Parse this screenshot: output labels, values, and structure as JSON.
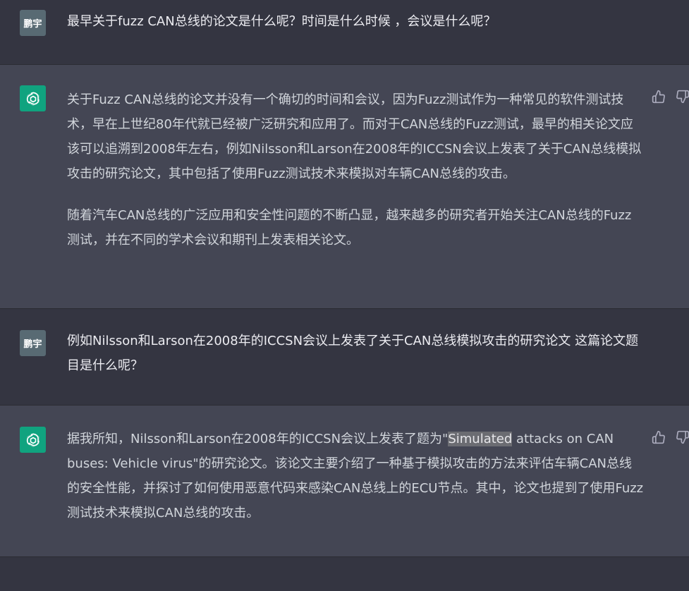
{
  "messages": [
    {
      "role": "user",
      "avatar": "鹏宇",
      "text": "最早关于fuzz CAN总线的论文是什么呢？时间是什么时候 ，会议是什么呢？"
    },
    {
      "role": "assistant",
      "avatar_icon": "openai-logo-icon",
      "paragraphs": [
        "关于Fuzz CAN总线的论文并没有一个确切的时间和会议，因为Fuzz测试作为一种常见的软件测试技术，早在上世纪80年代就已经被广泛研究和应用了。而对于CAN总线的Fuzz测试，最早的相关论文应该可以追溯到2008年左右，例如Nilsson和Larson在2008年的ICCSN会议上发表了关于CAN总线模拟攻击的研究论文，其中包括了使用Fuzz测试技术来模拟对车辆CAN总线的攻击。",
        "随着汽车CAN总线的广泛应用和安全性问题的不断凸显，越来越多的研究者开始关注CAN总线的Fuzz测试，并在不同的学术会议和期刊上发表相关论文。"
      ]
    },
    {
      "role": "user",
      "avatar": "鹏宇",
      "text": "例如Nilsson和Larson在2008年的ICCSN会议上发表了关于CAN总线模拟攻击的研究论文 这篇论文题目是什么呢？"
    },
    {
      "role": "assistant",
      "avatar_icon": "openai-logo-icon",
      "text_before": "据我所知，Nilsson和Larson在2008年的ICCSN会议上发表了题为\"",
      "text_highlight": "Simulated",
      "text_after": " attacks on CAN buses: Vehicle virus\"的研究论文。该论文主要介绍了一种基于模拟攻击的方法来评估车辆CAN总线的安全性能，并探讨了如何使用恶意代码来感染CAN总线上的ECU节点。其中，论文也提到了使用Fuzz测试技术来模拟CAN总线的攻击。"
    }
  ],
  "actions": [
    "thumbs-up-icon",
    "thumbs-down-icon"
  ],
  "colors": {
    "user_bg": "#343541",
    "assistant_bg": "#444654",
    "openai_green": "#10a37f",
    "text": "#d1d5db"
  }
}
